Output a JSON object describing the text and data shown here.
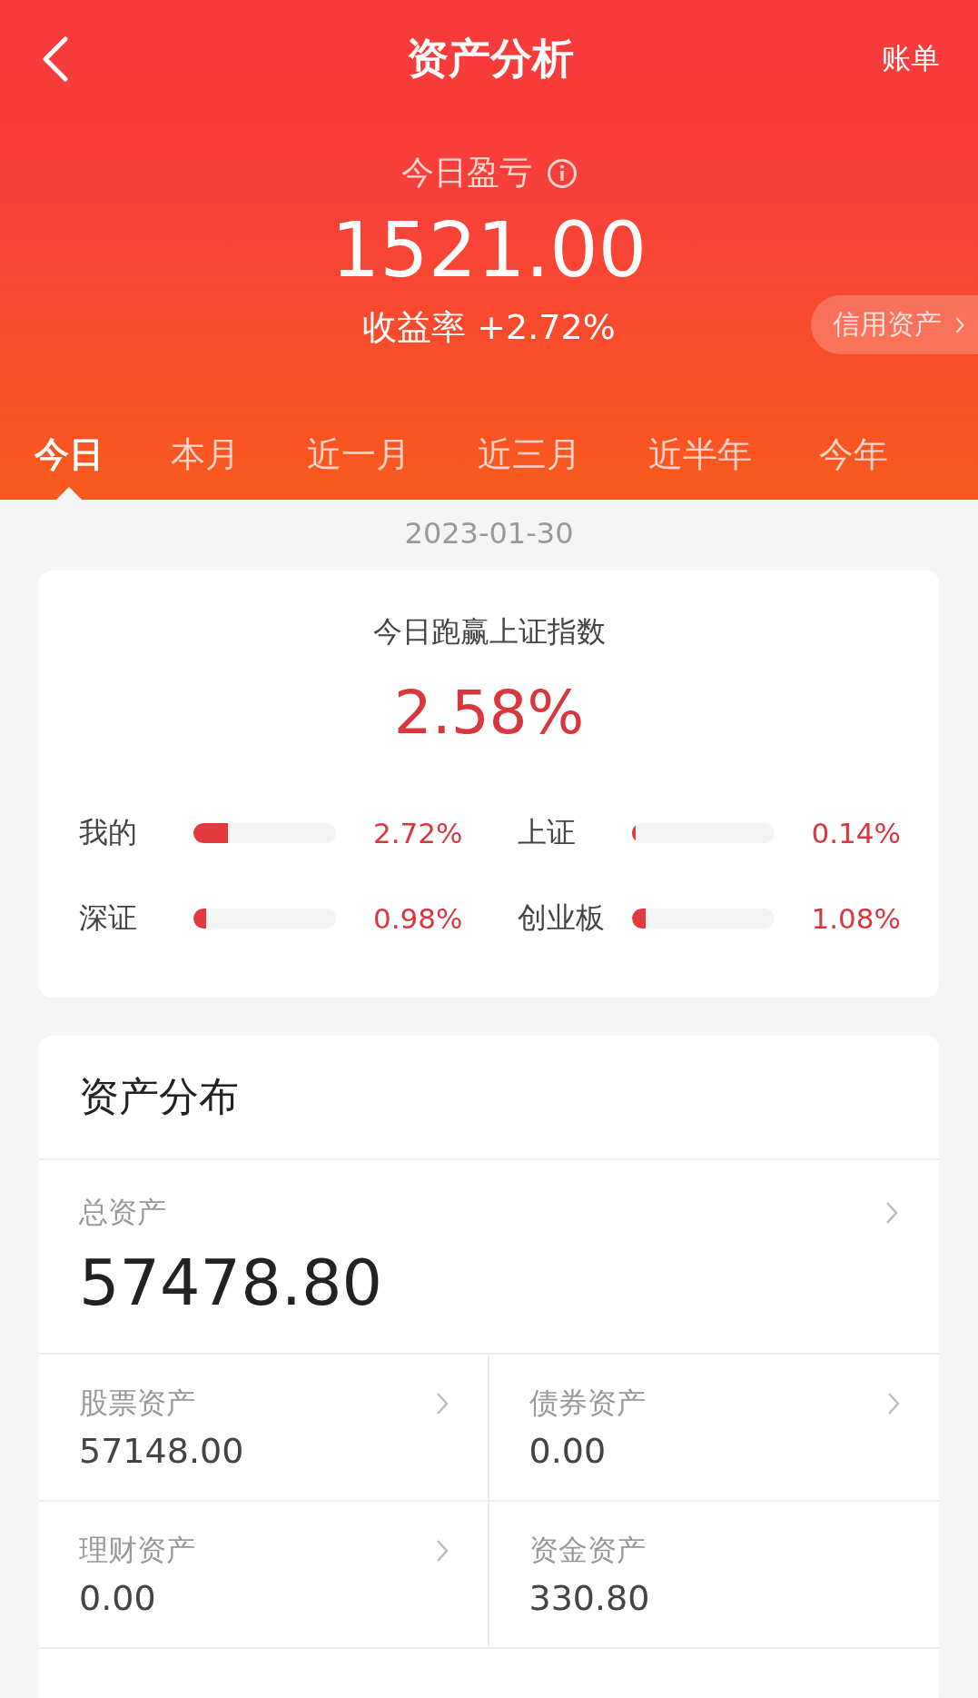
{
  "header": {
    "title": "资产分析",
    "action": "账单"
  },
  "summary": {
    "label": "今日盈亏",
    "amount": "1521.00",
    "return_rate": "收益率 +2.72%",
    "credit_link": "信用资产"
  },
  "tabs": [
    {
      "label": "今日",
      "selected": true
    },
    {
      "label": "本月",
      "selected": false
    },
    {
      "label": "近一月",
      "selected": false
    },
    {
      "label": "近三月",
      "selected": false
    },
    {
      "label": "近半年",
      "selected": false
    },
    {
      "label": "今年",
      "selected": false
    }
  ],
  "date": "2023-01-30",
  "comparison": {
    "title": "今日跑赢上证指数",
    "value": "2.58%",
    "items": [
      {
        "name": "我的",
        "level": 0.24,
        "reading": "2.72%"
      },
      {
        "name": "上证",
        "level": 0.02,
        "reading": "0.14%"
      },
      {
        "name": "深证",
        "level": 0.09,
        "reading": "0.98%"
      },
      {
        "name": "创业板",
        "level": 0.1,
        "reading": "1.08%"
      }
    ]
  },
  "distribution": {
    "title": "资产分布",
    "total": {
      "label": "总资产",
      "value": "57478.80",
      "chevron": true
    },
    "items": [
      {
        "label": "股票资产",
        "value": "57148.00",
        "chevron": true
      },
      {
        "label": "债券资产",
        "value": "0.00",
        "chevron": true
      },
      {
        "label": "理财资产",
        "value": "0.00",
        "chevron": true
      },
      {
        "label": "资金资产",
        "value": "330.80",
        "chevron": false
      }
    ]
  }
}
